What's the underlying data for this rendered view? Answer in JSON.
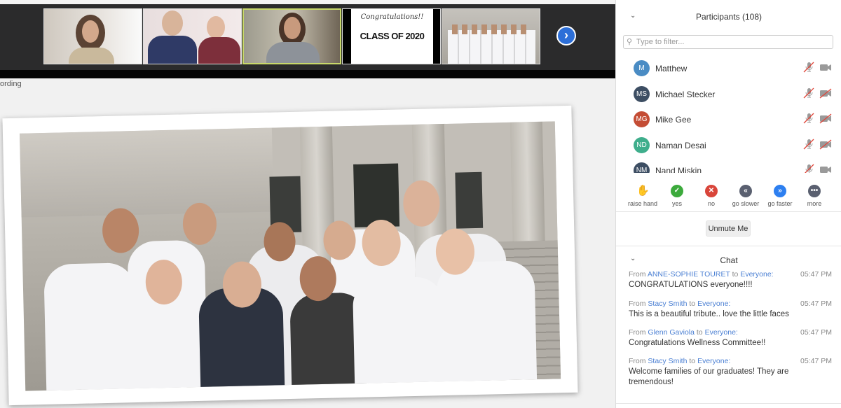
{
  "recording_label": "ording",
  "thumbnails": [
    {
      "name": "video-tile-woman-glasses"
    },
    {
      "name": "video-tile-family"
    },
    {
      "name": "video-tile-speaker",
      "active": true
    },
    {
      "name": "video-tile-congrats",
      "line1": "Congratulations!!",
      "line2": "CLASS OF 2020"
    },
    {
      "name": "video-tile-group"
    }
  ],
  "next_icon": "chevron-right-icon",
  "participants": {
    "title": "Participants (108)",
    "filter_placeholder": "Type to filter...",
    "list": [
      {
        "initials": "M",
        "name": "Matthew",
        "color": "#4a8cc4",
        "video_off": false
      },
      {
        "initials": "MS",
        "name": "Michael Stecker",
        "color": "#3d4e63",
        "video_off": true
      },
      {
        "initials": "MG",
        "name": "Mike Gee",
        "color": "#c44d35",
        "video_off": true
      },
      {
        "initials": "ND",
        "name": "Naman Desai",
        "color": "#3fae8c",
        "video_off": true
      },
      {
        "initials": "NM",
        "name": "Nand Miskin",
        "color": "#3d4e63",
        "video_off": false
      }
    ],
    "reactions": [
      {
        "label": "raise hand",
        "glyph": "✋",
        "color": "#3b7be0"
      },
      {
        "label": "yes",
        "glyph": "✓",
        "color": "#3caa3c"
      },
      {
        "label": "no",
        "glyph": "✕",
        "color": "#d9453a"
      },
      {
        "label": "go slower",
        "glyph": "«",
        "color": "#5a6070"
      },
      {
        "label": "go faster",
        "glyph": "»",
        "color": "#2d7ff0"
      },
      {
        "label": "more",
        "glyph": "•••",
        "color": "#5a6070"
      }
    ],
    "unmute_label": "Unmute Me"
  },
  "chat": {
    "title": "Chat",
    "messages": [
      {
        "from_word": "From",
        "sender": "ANNE-SOPHIE TOURET",
        "to_word": "to",
        "recipient": "Everyone:",
        "time": "05:47 PM",
        "text": "CONGRATULATIONS everyone!!!!"
      },
      {
        "from_word": "From",
        "sender": "Stacy Smith",
        "to_word": "to",
        "recipient": "Everyone:",
        "time": "05:47 PM",
        "text": "This is a beautiful tribute.. love the little faces"
      },
      {
        "from_word": "From",
        "sender": "Glenn Gaviola",
        "to_word": "to",
        "recipient": "Everyone:",
        "time": "05:47 PM",
        "text": "Congratulations Wellness Committee!!"
      },
      {
        "from_word": "From",
        "sender": "Stacy Smith",
        "to_word": "to",
        "recipient": "Everyone:",
        "time": "05:47 PM",
        "text": "Welcome families of our graduates! They are tremendous!"
      }
    ]
  }
}
